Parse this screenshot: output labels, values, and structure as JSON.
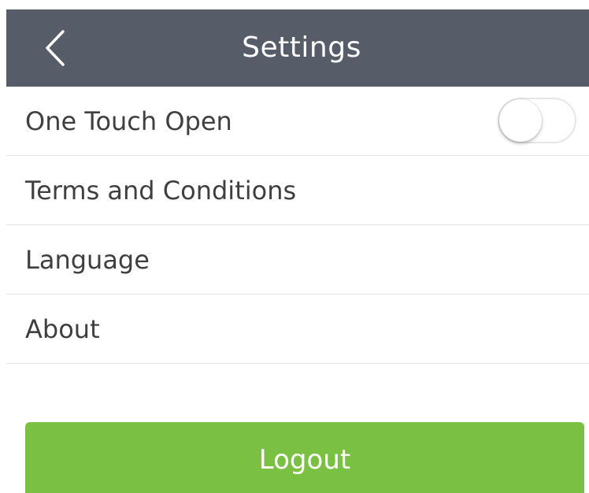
{
  "header": {
    "title": "Settings",
    "back_icon": "chevron-left-icon"
  },
  "settings": {
    "items": [
      {
        "label": "One Touch Open",
        "control": "toggle",
        "toggle_on": false
      },
      {
        "label": "Terms and Conditions"
      },
      {
        "label": "Language"
      },
      {
        "label": "About"
      }
    ]
  },
  "actions": {
    "logout_label": "Logout"
  },
  "colors": {
    "header_bg": "#565d68",
    "logout_bg": "#7ac043",
    "text": "#3f3f3f",
    "divider": "#e3e3e3"
  }
}
